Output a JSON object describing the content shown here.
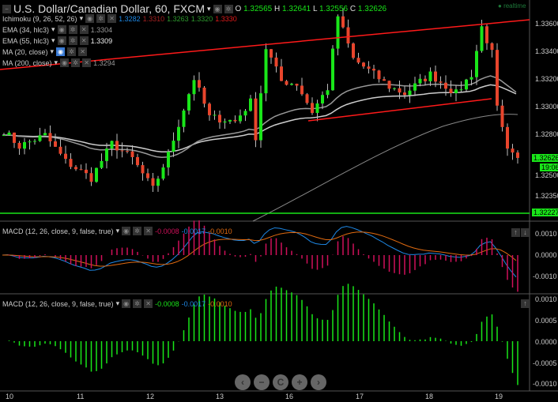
{
  "header": {
    "title": "U.S. Dollar/Canadian Dollar, 60, FXCM",
    "o_label": "O",
    "o": "1.32565",
    "h_label": "H",
    "h": "1.32641",
    "l_label": "L",
    "l": "1.32556",
    "c_label": "C",
    "c": "1.32626",
    "realtime": "realtime"
  },
  "indicators": [
    {
      "name": "Ichimoku (9, 26, 52, 26)",
      "values": [
        "1.3282",
        "1.3310",
        "1.3263",
        "1.3320",
        "1.3330"
      ]
    },
    {
      "name": "EMA (34, hlc3)",
      "values": [
        "1.3304"
      ]
    },
    {
      "name": "EMA (55, hlc3)",
      "values": [
        "1.3309"
      ]
    },
    {
      "name": "MA (20, close)",
      "values": []
    },
    {
      "name": "MA (200, close)",
      "values": [
        "1.3294"
      ]
    }
  ],
  "macd1": {
    "name": "MACD (12, 26, close, 9, false, true)",
    "hist": "-0.0008",
    "macd": "-0.0017",
    "signal": "-0.0010",
    "ticks": [
      "0.0010",
      "0.0000",
      "-0.0010"
    ]
  },
  "macd2": {
    "name": "MACD (12, 26, close, 9, false, true)",
    "hist": "-0.0008",
    "macd": "-0.0017",
    "signal": "-0.0010",
    "ticks": [
      "0.0010",
      "0.0005",
      "0.0000",
      "-0.0005",
      "-0.0010"
    ]
  },
  "price_axis": {
    "ticks": [
      "1.33600",
      "1.33400",
      "1.33200",
      "1.33000",
      "1.32800",
      "1.32500",
      "1.32350"
    ],
    "current": "1.32626",
    "countdown": "19:06",
    "level": "1.32227"
  },
  "time_axis": [
    "10",
    "11",
    "12",
    "13",
    "16",
    "17",
    "18",
    "19"
  ],
  "nav": {
    "left": "‹",
    "minus": "−",
    "reset": "C",
    "plus": "+",
    "right": "›"
  },
  "colors": {
    "up": "#19e619",
    "down": "#e8452c",
    "trend": "#ff1a1a",
    "level": "#19e619",
    "macd": "#1e88e5",
    "signal": "#e06a10",
    "hist1": "#d0105a",
    "hist2": "#19e619"
  },
  "chart_data": {
    "type": "candlestick",
    "waypoints": [
      [
        0,
        1.3282
      ],
      [
        3,
        1.3271
      ],
      [
        8,
        1.3279
      ],
      [
        12,
        1.326
      ],
      [
        17,
        1.3248
      ],
      [
        21,
        1.3273
      ],
      [
        25,
        1.3262
      ],
      [
        29,
        1.324
      ],
      [
        32,
        1.3265
      ],
      [
        37,
        1.332
      ],
      [
        40,
        1.3292
      ],
      [
        45,
        1.3289
      ],
      [
        48,
        1.3303
      ],
      [
        49,
        1.3278
      ],
      [
        51,
        1.3342
      ],
      [
        54,
        1.3318
      ],
      [
        57,
        1.3316
      ],
      [
        60,
        1.3296
      ],
      [
        63,
        1.3313
      ],
      [
        65,
        1.3365
      ],
      [
        68,
        1.3334
      ],
      [
        72,
        1.3323
      ],
      [
        75,
        1.3314
      ],
      [
        78,
        1.3309
      ],
      [
        83,
        1.3323
      ],
      [
        88,
        1.3309
      ],
      [
        91,
        1.3323
      ],
      [
        93,
        1.3357
      ],
      [
        95,
        1.3338
      ],
      [
        96,
        1.3298
      ],
      [
        98,
        1.3267
      ],
      [
        100,
        1.3261
      ]
    ]
  }
}
